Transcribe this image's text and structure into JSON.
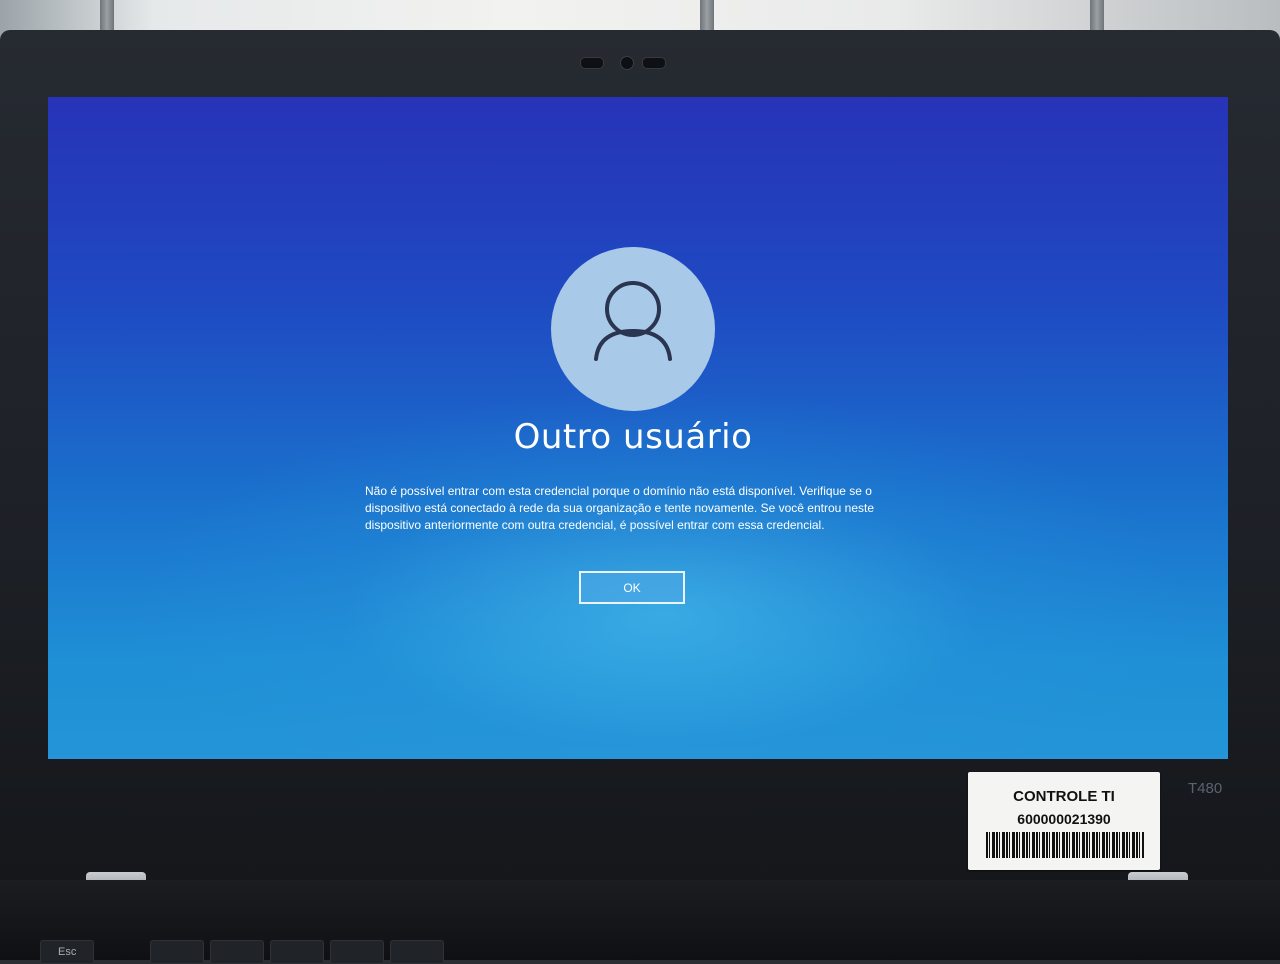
{
  "login": {
    "user_name": "Outro usuário",
    "message": "Não é possível entrar com esta credencial porque o domínio não está disponível. Verifique se o dispositivo está conectado à rede da sua organização e tente novamente. Se você entrou neste dispositivo anteriormente com outra credencial, é possível entrar com essa credencial.",
    "ok_label": "OK",
    "avatar_icon": "user-silhouette-icon"
  },
  "device": {
    "model_label": "T480",
    "asset_sticker_title": "CONTROLE TI",
    "asset_sticker_number": "600000021390",
    "esc_key_label": "Esc"
  },
  "colors": {
    "screen_top": "#2733b8",
    "screen_bottom": "#2595d8",
    "avatar_circle": "#a9c9e8",
    "avatar_icon": "#2a3550",
    "text": "#ffffff"
  }
}
